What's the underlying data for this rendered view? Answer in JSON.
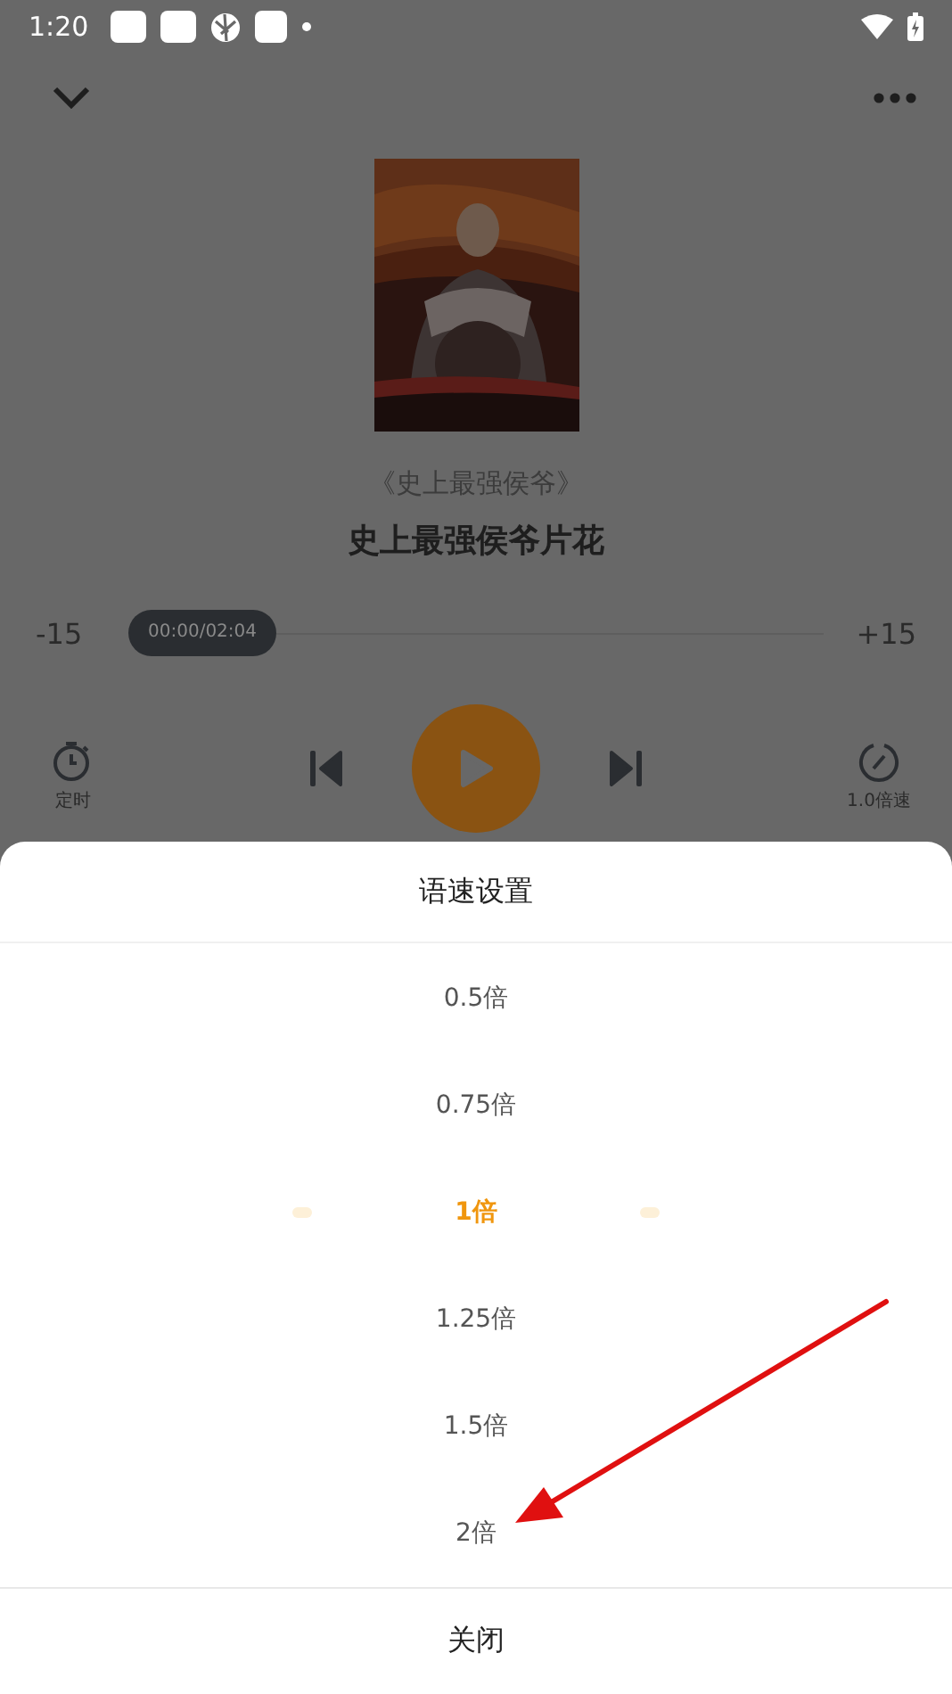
{
  "status_bar": {
    "time": "1:20"
  },
  "player": {
    "book_title": "《史上最强侯爷》",
    "episode_title": "史上最强侯爷片花",
    "rewind": "-15",
    "forward": "+15",
    "position": "00:00/02:04",
    "playing": false,
    "timer_label": "定时",
    "speed_label": "1.0倍速"
  },
  "speed_sheet": {
    "title": "语速设置",
    "options": [
      {
        "label": "0.5倍",
        "selected": false
      },
      {
        "label": "0.75倍",
        "selected": false
      },
      {
        "label": "1倍",
        "selected": true
      },
      {
        "label": "1.25倍",
        "selected": false
      },
      {
        "label": "1.5倍",
        "selected": false
      },
      {
        "label": "2倍",
        "selected": false
      }
    ],
    "close": "关闭"
  }
}
